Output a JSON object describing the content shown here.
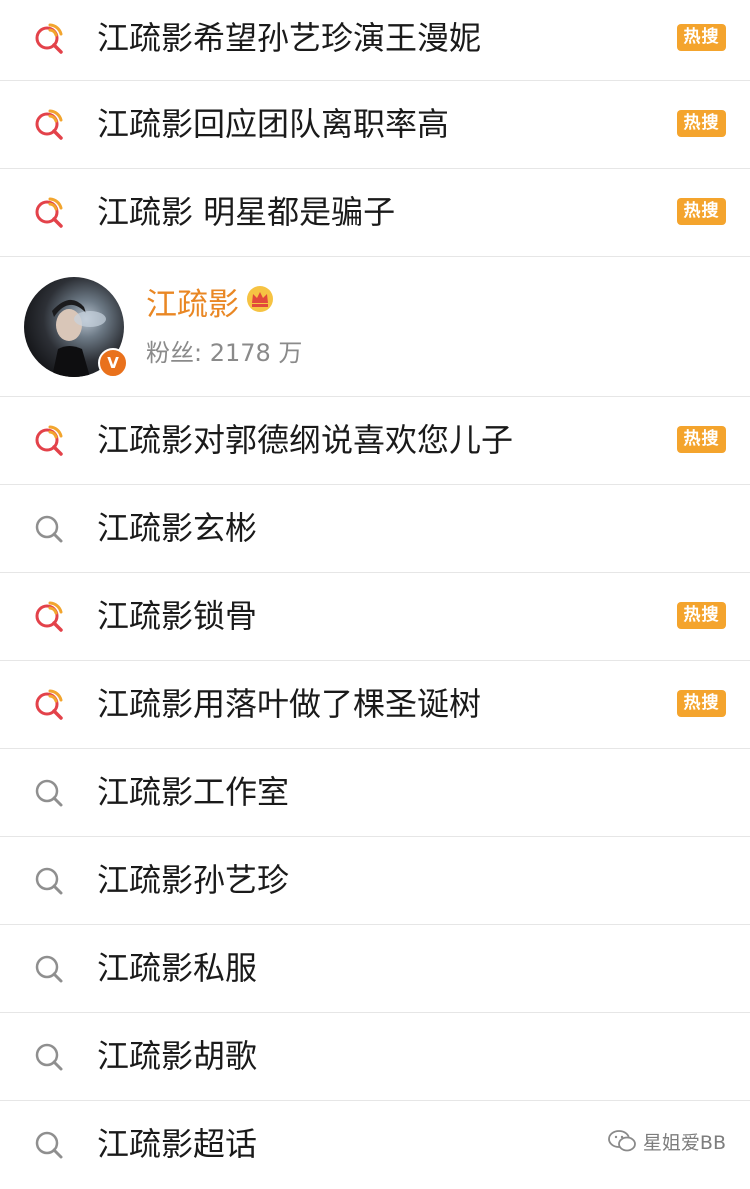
{
  "badge_label": "热搜",
  "colors": {
    "hot_badge": "#f4a42d",
    "name": "#e98724",
    "icon_red": "#e3424a",
    "icon_orange": "#f2a52e",
    "icon_gray": "#8f8f8f"
  },
  "rows": [
    {
      "label": "江疏影希望孙艺珍演王漫妮",
      "hot": true,
      "icon": "hot-search-icon"
    },
    {
      "label": "江疏影回应团队离职率高",
      "hot": true,
      "icon": "hot-search-icon"
    },
    {
      "label": "江疏影 明星都是骗子",
      "hot": true,
      "icon": "hot-search-icon"
    },
    {
      "label": "江疏影对郭德纲说喜欢您儿子",
      "hot": true,
      "icon": "hot-search-icon"
    },
    {
      "label": "江疏影玄彬",
      "hot": false,
      "icon": "search-icon"
    },
    {
      "label": "江疏影锁骨",
      "hot": true,
      "icon": "hot-search-icon"
    },
    {
      "label": "江疏影用落叶做了棵圣诞树",
      "hot": true,
      "icon": "hot-search-icon"
    },
    {
      "label": "江疏影工作室",
      "hot": false,
      "icon": "search-icon"
    },
    {
      "label": "江疏影孙艺珍",
      "hot": false,
      "icon": "search-icon"
    },
    {
      "label": "江疏影私服",
      "hot": false,
      "icon": "search-icon"
    },
    {
      "label": "江疏影胡歌",
      "hot": false,
      "icon": "search-icon"
    },
    {
      "label": "江疏影超话",
      "hot": false,
      "icon": "search-icon"
    }
  ],
  "user": {
    "name": "江疏影",
    "fans": "粉丝: 2178 万",
    "verified_mark": "V",
    "icons": [
      "avatar",
      "crown-icon",
      "verified-icon"
    ]
  },
  "watermark": {
    "text": "星姐爱BB",
    "icon": "wechat-icon"
  }
}
